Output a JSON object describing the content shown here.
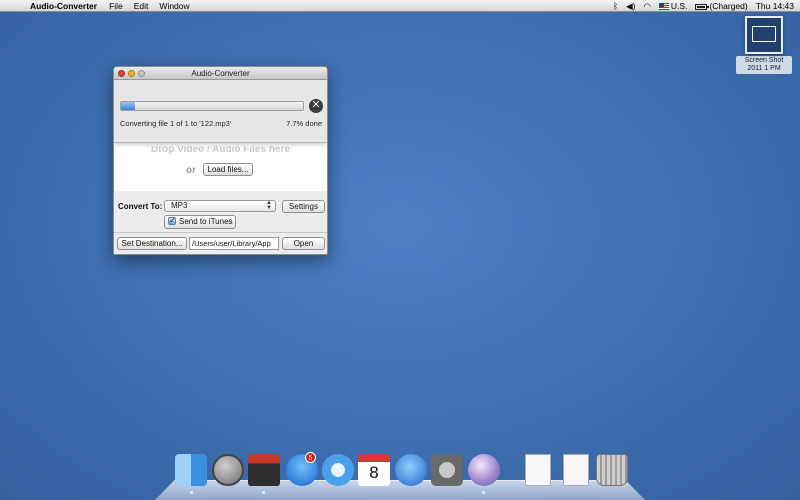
{
  "menubar": {
    "apple_icon": "apple-icon",
    "app_name": "Audio-Converter",
    "items": [
      "File",
      "Edit",
      "Window"
    ],
    "status": {
      "input_source": "U.S.",
      "battery": "(Charged)",
      "clock": "Thu 14:43"
    }
  },
  "desktop": {
    "icon_label_line1": "Screen Shot",
    "icon_label_line2": "2011 1 PM"
  },
  "window": {
    "title": "Audio-Converter",
    "progress": {
      "fraction": 0.077,
      "status_text": "Converting file 1 of 1 to '122.mp3'",
      "percent_text": "7.7% done",
      "stop_symbol": "✕"
    },
    "drop": {
      "hint": "Drop Video / Audio Files here",
      "or": "or",
      "load_button": "Load files..."
    },
    "convert": {
      "label": "Convert To:",
      "selected": "MP3",
      "settings_button": "Settings",
      "send_itunes": "Send to iTunes",
      "send_itunes_checked": true
    },
    "destination": {
      "set_button": "Set Destination...",
      "path": "/Users/user/Library/App",
      "open_button": "Open"
    }
  },
  "dock": {
    "items": [
      "finder",
      "launchpad",
      "photo-booth",
      "app-store",
      "safari",
      "ical",
      "itunes",
      "system-preferences",
      "dvd-player",
      "document",
      "document",
      "trash"
    ],
    "app_store_badge": "5",
    "ical_day": "8"
  }
}
